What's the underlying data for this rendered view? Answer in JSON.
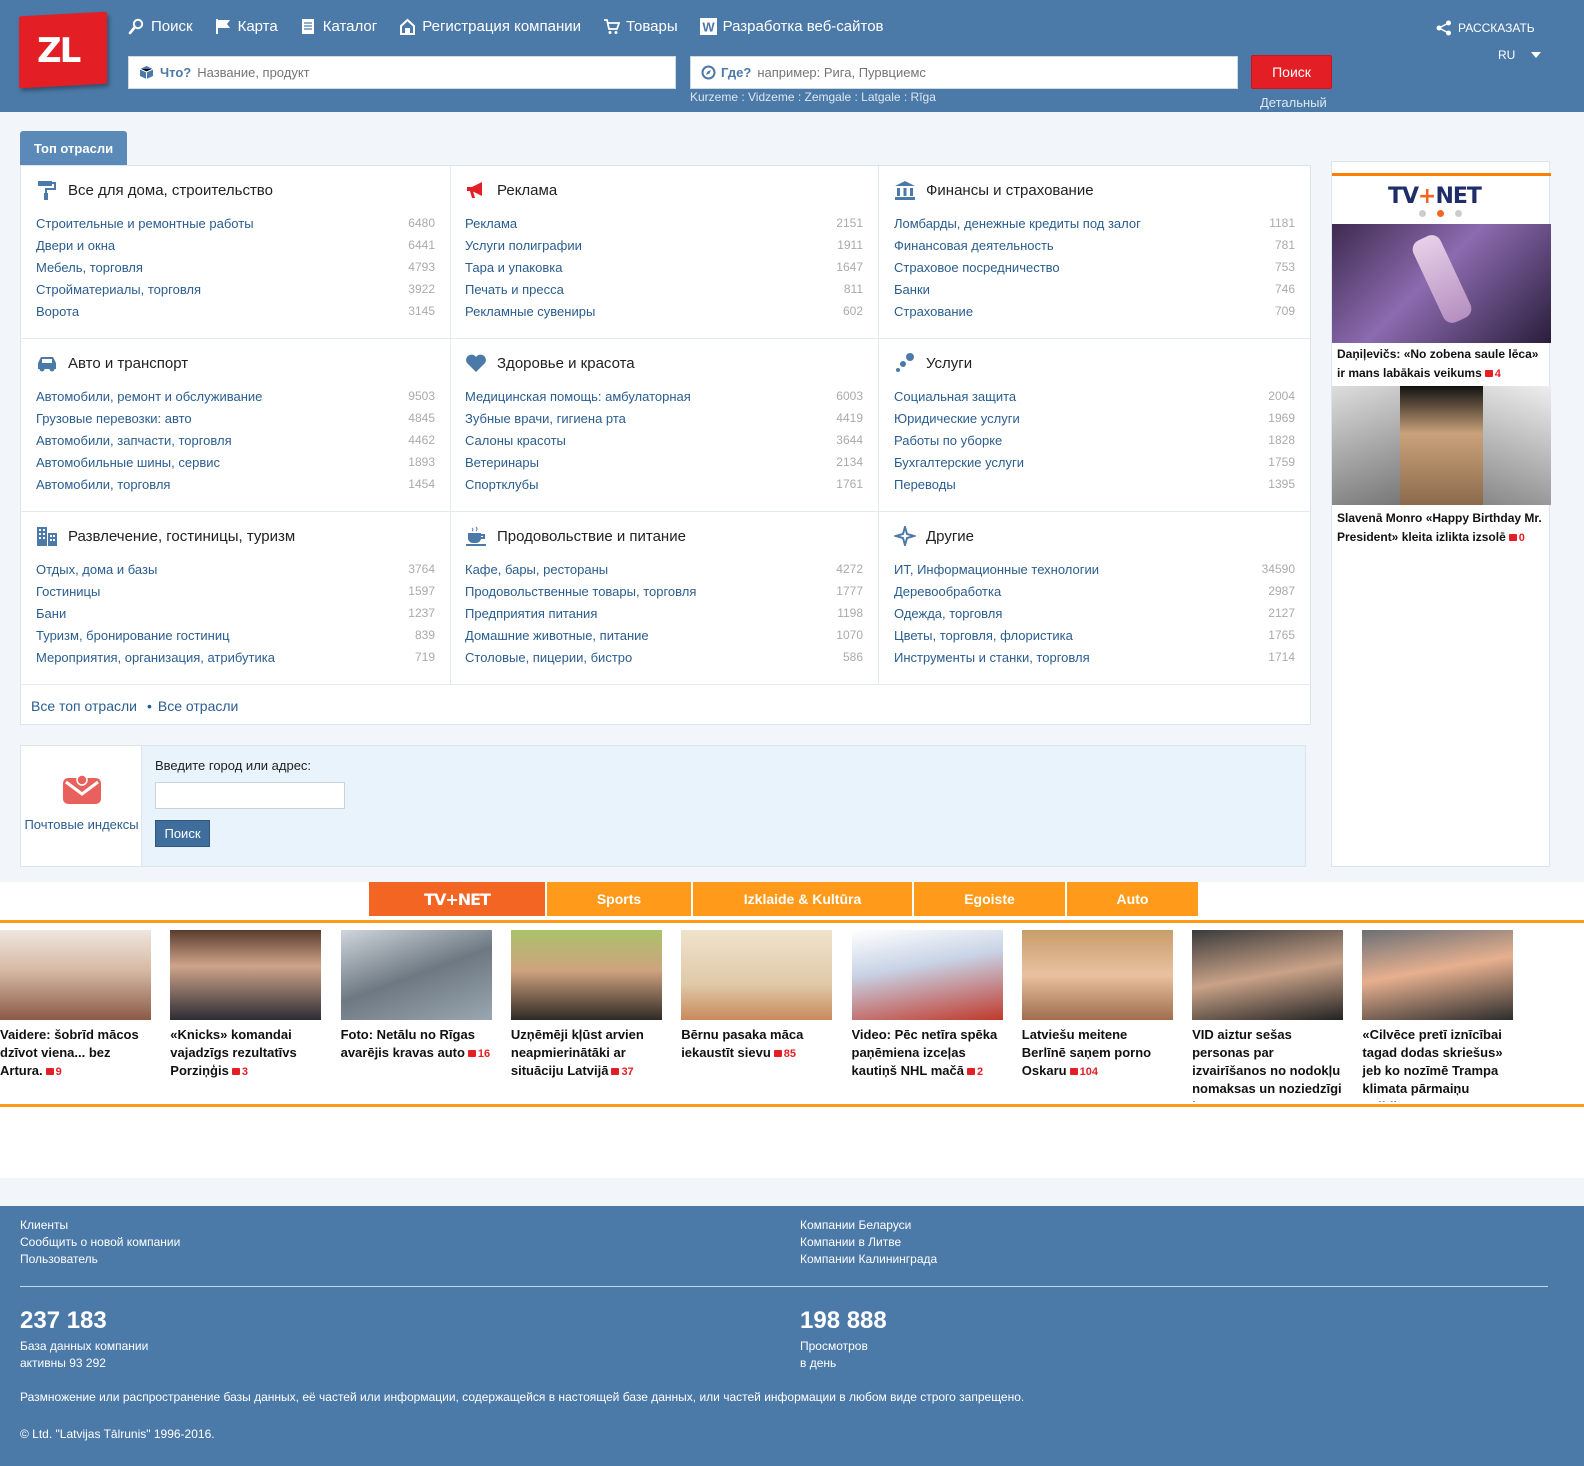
{
  "header": {
    "logo": "ZL",
    "nav": [
      {
        "label": "Поиск",
        "icon": "search-icon"
      },
      {
        "label": "Карта",
        "icon": "flag-icon"
      },
      {
        "label": "Каталог",
        "icon": "catalog-icon"
      },
      {
        "label": "Регистрация компании",
        "icon": "register-icon"
      },
      {
        "label": "Товары",
        "icon": "cart-icon"
      },
      {
        "label": "Разработка веб-сайтов",
        "icon": "w-icon"
      }
    ],
    "what_label": "Что?",
    "what_placeholder": "Название, продукт",
    "where_label": "Где?",
    "where_placeholder": "например: Рига, Пурвциемс",
    "search_button": "Поиск",
    "regions": "Kurzeme : Vidzeme : Zemgale : Latgale : Rīga",
    "detailed": "Детальный",
    "share": "РАССКАЗАТЬ",
    "lang": "RU"
  },
  "top_tab": "Топ отрасли",
  "categories": [
    {
      "title": "Все для дома, строительство",
      "icon": "paint-roller-icon",
      "items": [
        {
          "label": "Строительные и ремонтные работы",
          "count": "6480"
        },
        {
          "label": "Двери и окна",
          "count": "6441"
        },
        {
          "label": "Мебель, торговля",
          "count": "4793"
        },
        {
          "label": "Стройматериалы, торговля",
          "count": "3922"
        },
        {
          "label": "Ворота",
          "count": "3145"
        }
      ]
    },
    {
      "title": "Реклама",
      "icon": "megaphone-icon",
      "items": [
        {
          "label": "Реклама",
          "count": "2151"
        },
        {
          "label": "Услуги полиграфии",
          "count": "1911"
        },
        {
          "label": "Тара и упаковка",
          "count": "1647"
        },
        {
          "label": "Печать и пресса",
          "count": "811"
        },
        {
          "label": "Рекламные сувениры",
          "count": "602"
        }
      ]
    },
    {
      "title": "Финансы и страхование",
      "icon": "bank-icon",
      "items": [
        {
          "label": "Ломбарды, денежные кредиты под залог",
          "count": "1181"
        },
        {
          "label": "Финансовая деятельность",
          "count": "781"
        },
        {
          "label": "Страховое посредничество",
          "count": "753"
        },
        {
          "label": "Банки",
          "count": "746"
        },
        {
          "label": "Страхование",
          "count": "709"
        }
      ]
    },
    {
      "title": "Авто и транспорт",
      "icon": "car-icon",
      "items": [
        {
          "label": "Автомобили, ремонт и обслуживание",
          "count": "9503"
        },
        {
          "label": "Грузовые перевозки: авто",
          "count": "4845"
        },
        {
          "label": "Автомобили, запчасти, торговля",
          "count": "4462"
        },
        {
          "label": "Автомобильные шины, сервис",
          "count": "1893"
        },
        {
          "label": "Автомобили, торговля",
          "count": "1454"
        }
      ]
    },
    {
      "title": "Здоровье и красота",
      "icon": "heart-icon",
      "items": [
        {
          "label": "Медицинская помощь: амбулаторная",
          "count": "6003"
        },
        {
          "label": "Зубные врачи, гигиена рта",
          "count": "4419"
        },
        {
          "label": "Салоны красоты",
          "count": "3644"
        },
        {
          "label": "Ветеринары",
          "count": "2134"
        },
        {
          "label": "Спортклубы",
          "count": "1761"
        }
      ]
    },
    {
      "title": "Услуги",
      "icon": "dots-icon",
      "items": [
        {
          "label": "Социальная защита",
          "count": "2004"
        },
        {
          "label": "Юридические услуги",
          "count": "1969"
        },
        {
          "label": "Работы по уборке",
          "count": "1828"
        },
        {
          "label": "Бухгалтерские услуги",
          "count": "1759"
        },
        {
          "label": "Переводы",
          "count": "1395"
        }
      ]
    },
    {
      "title": "Развлечение, гостиницы, туризм",
      "icon": "building-icon",
      "items": [
        {
          "label": "Отдых, дома и базы",
          "count": "3764"
        },
        {
          "label": "Гостиницы",
          "count": "1597"
        },
        {
          "label": "Бани",
          "count": "1237"
        },
        {
          "label": "Туризм, бронирование гостиниц",
          "count": "839"
        },
        {
          "label": "Мероприятия, организация, атрибутика",
          "count": "719"
        }
      ]
    },
    {
      "title": "Продовольствие и питание",
      "icon": "coffee-cup-icon",
      "items": [
        {
          "label": "Кафе, бары, рестораны",
          "count": "4272"
        },
        {
          "label": "Продовольственные товары, торговля",
          "count": "1777"
        },
        {
          "label": "Предприятия питания",
          "count": "1198"
        },
        {
          "label": "Домашние животные, питание",
          "count": "1070"
        },
        {
          "label": "Столовые, пицерии, бистро",
          "count": "586"
        }
      ]
    },
    {
      "title": "Другие",
      "icon": "star-icon",
      "items": [
        {
          "label": "ИТ, Информационные технологии",
          "count": "34590"
        },
        {
          "label": "Деревообработка",
          "count": "2987"
        },
        {
          "label": "Одежда, торговля",
          "count": "2127"
        },
        {
          "label": "Цветы, торговля, флористика",
          "count": "1765"
        },
        {
          "label": "Инструменты и станки, торговля",
          "count": "1714"
        }
      ]
    }
  ],
  "grid_footer": {
    "all_top": "Все топ отрасли",
    "all": "Все отрасли"
  },
  "postal": {
    "label": "Почтовые индексы",
    "prompt": "Введите город или адрес:",
    "button": "Поиск"
  },
  "ad": {
    "logo_a": "TV",
    "logo_plus": "+",
    "logo_b": "NET",
    "items": [
      {
        "caption": "Daņiļevičs: «No zobena saule lēca» ir mans labākais veikums",
        "comments": "4"
      },
      {
        "caption": "Slavenā Monro «Happy Birthday Mr. President» kleita izlikta izsolē",
        "comments": "0"
      }
    ]
  },
  "news": {
    "tabs": [
      "TV+NET",
      "Sports",
      "Izklaide & Kultūra",
      "Egoiste",
      "Auto"
    ],
    "items": [
      {
        "caption": "Vaidere: šobrīd mācos dzīvot viena... bez Artura.",
        "comments": "9"
      },
      {
        "caption": "«Knicks» komandai vajadzīgs rezultatīvs Porziņģis",
        "comments": "3"
      },
      {
        "caption": "Foto: Netālu no Rīgas avarējis kravas auto",
        "comments": "16"
      },
      {
        "caption": "Uzņēmēji kļūst arvien neapmierinātāki ar situāciju Latvijā",
        "comments": "37"
      },
      {
        "caption": "Bērnu pasaka māca iekaustīt sievu",
        "comments": "85"
      },
      {
        "caption": "Video: Pēc netīra spēka paņēmiena izceļas kautiņš NHL mačā",
        "comments": "2"
      },
      {
        "caption": "Latviešu meitene Berlīnē saņem porno Oskaru",
        "comments": "104"
      },
      {
        "caption": "VID aiztur sešas personas par izvairīšanos no nodokļu nomaksas un noziedzīgi iegūtu",
        "comments": ""
      },
      {
        "caption": "«Cilvēce pretī iznīcībai tagad dodas skriešus» jeb ko nozīmē Trampa klimata pārmaiņu politika",
        "comments": ""
      }
    ]
  },
  "footer": {
    "links_left": [
      "Клиенты",
      "Сообщить о новой компании",
      "Пользователь"
    ],
    "links_right": [
      "Компании Беларуси",
      "Компании в Литве",
      "Компании Калининграда"
    ],
    "stat1": {
      "value": "237 183",
      "line1": "База данных компании",
      "line2": "активны 93 292"
    },
    "stat2": {
      "value": "198 888",
      "line1": "Просмотров",
      "line2": "в день"
    },
    "note": "Размножение или распространение базы данных, её частей или информации, содержащейся в настоящей базе данных, или частей информации в любом виде строго запрещено.",
    "copyright": "© Ltd. \"Latvijas Tālrunis\" 1996-2016."
  },
  "colors": {
    "header": "#4c7aa8",
    "accent_red": "#e31e24",
    "orange": "#ff9a1a",
    "link": "#2a5d8f"
  }
}
